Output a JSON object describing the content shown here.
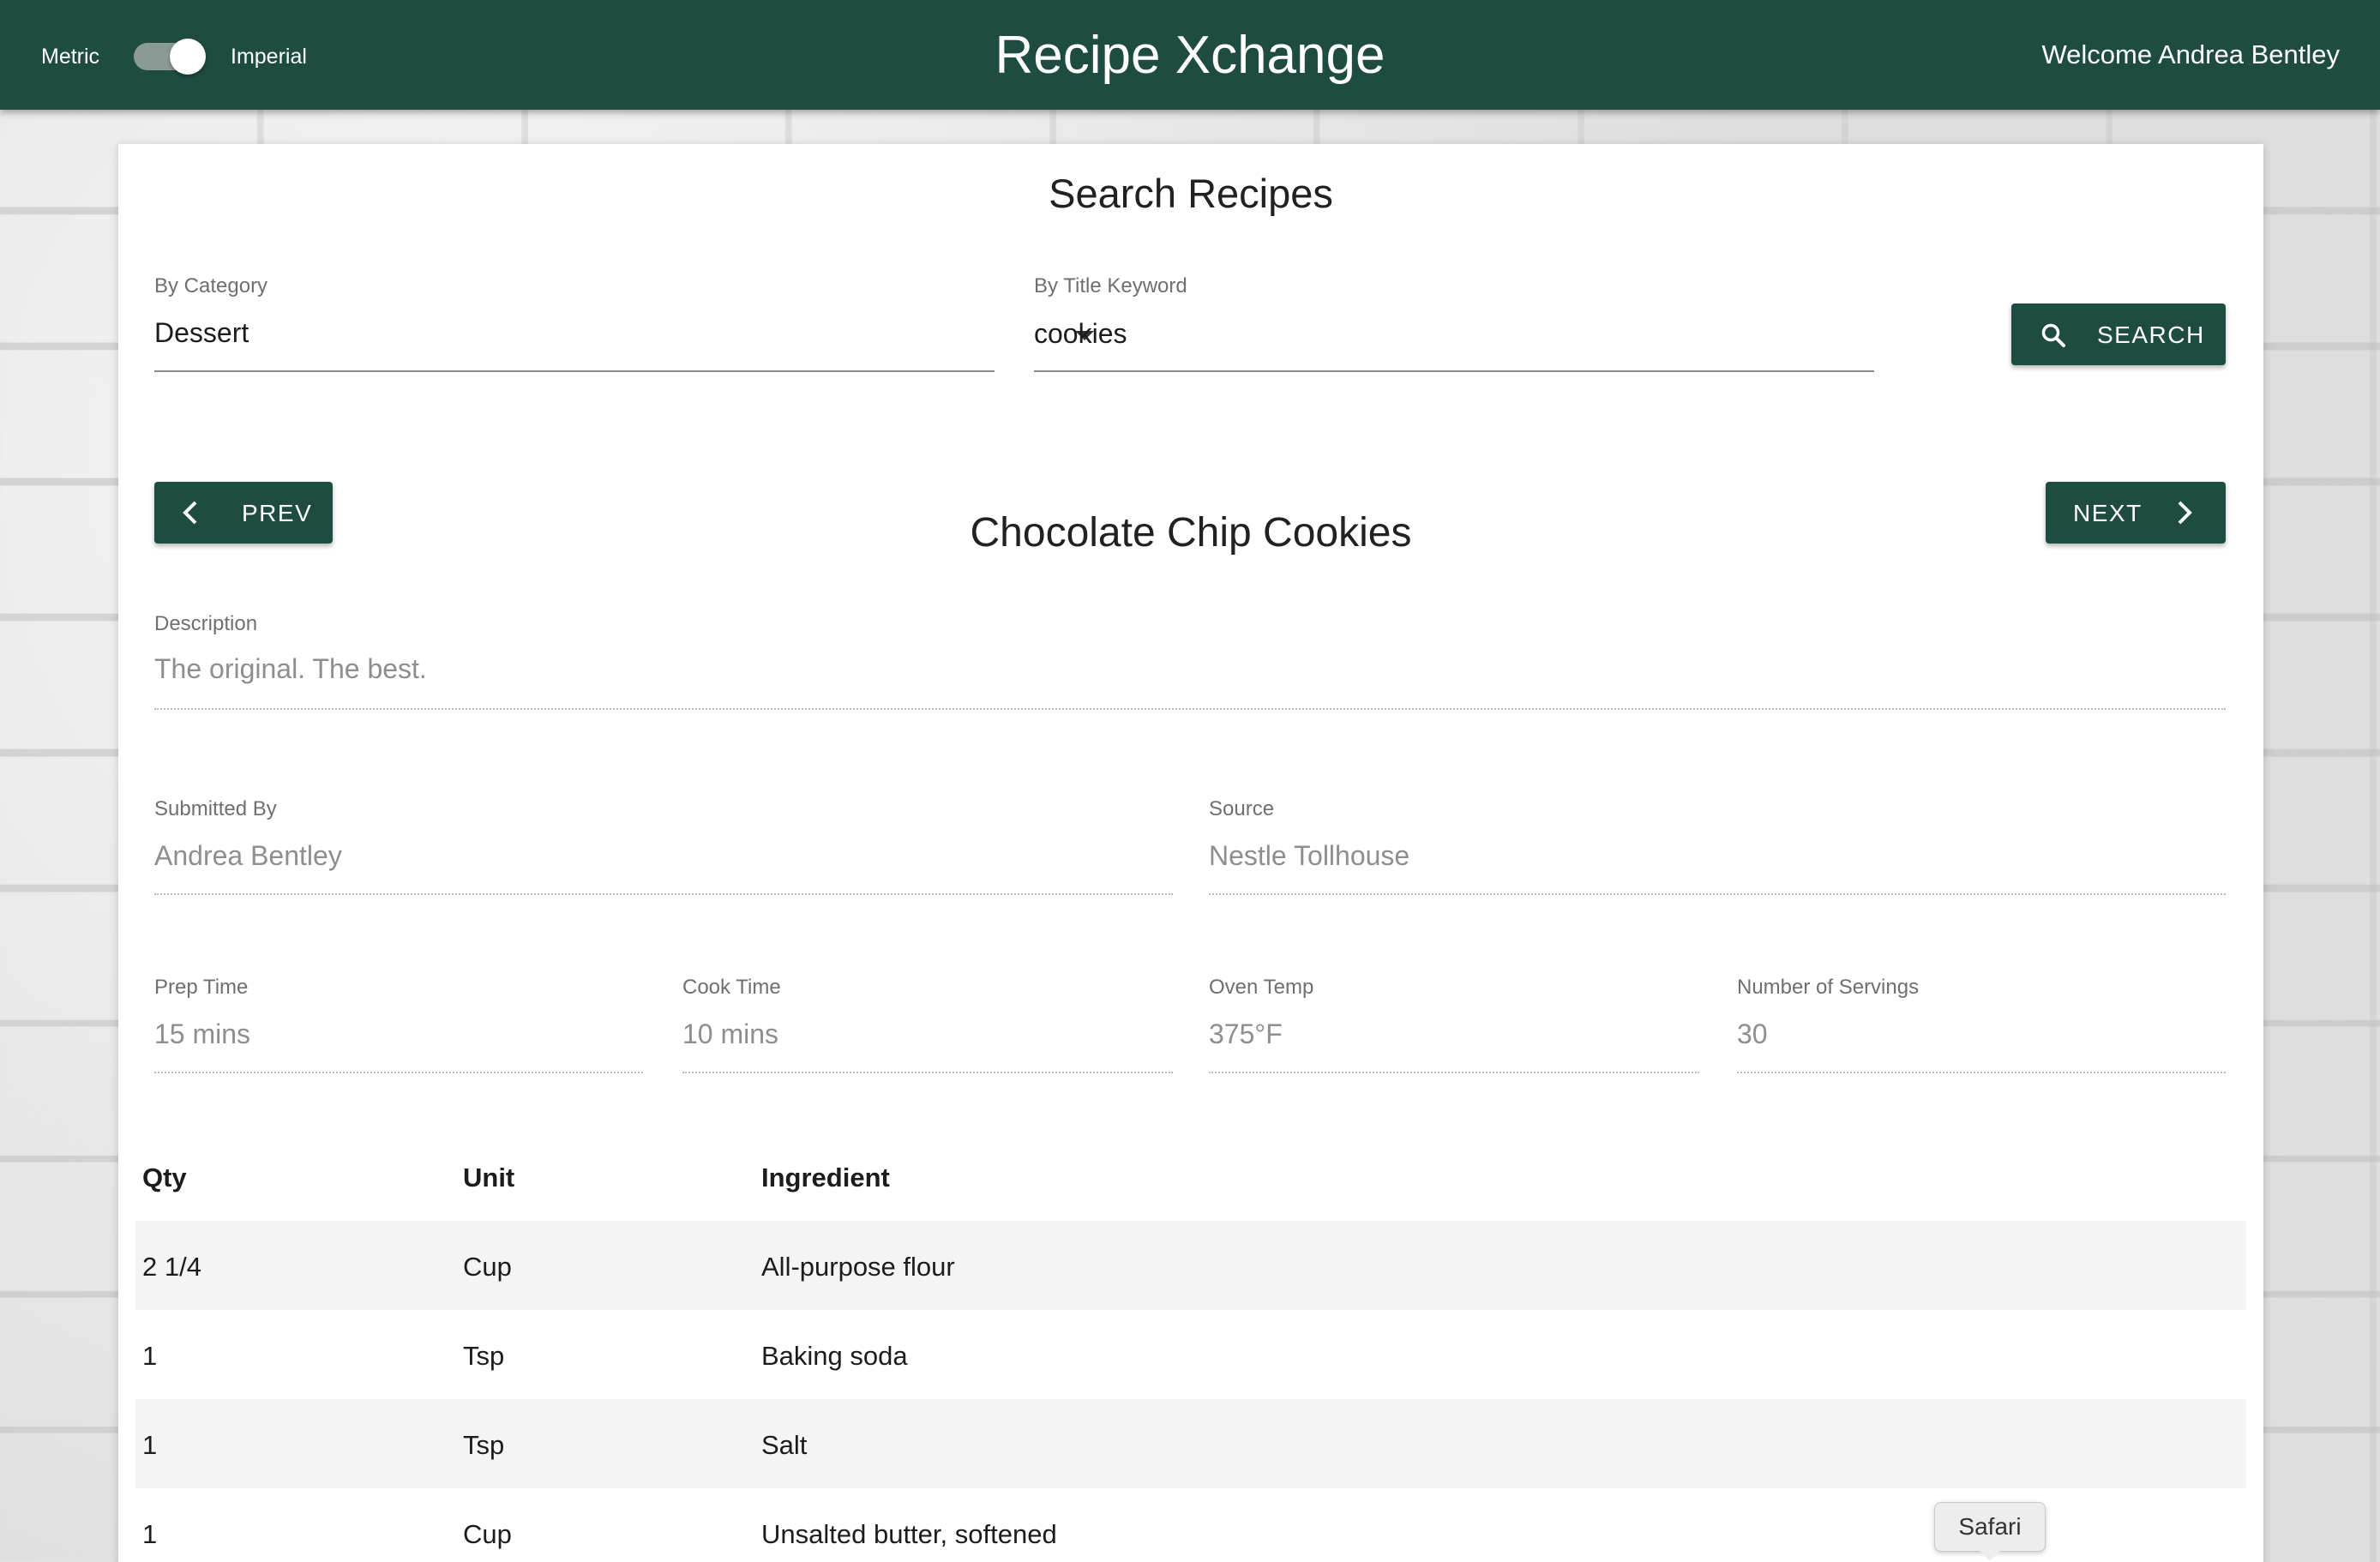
{
  "header": {
    "metric_label": "Metric",
    "imperial_label": "Imperial",
    "unit_toggle_on": true,
    "app_title": "Recipe Xchange",
    "welcome": "Welcome Andrea Bentley"
  },
  "search": {
    "title": "Search Recipes",
    "category_label": "By Category",
    "category_value": "Dessert",
    "keyword_label": "By Title Keyword",
    "keyword_value": "cookies",
    "search_button": "SEARCH"
  },
  "nav": {
    "prev": "PREV",
    "next": "NEXT"
  },
  "recipe": {
    "title": "Chocolate Chip Cookies",
    "description_label": "Description",
    "description": "The original. The best.",
    "submitted_by_label": "Submitted By",
    "submitted_by": "Andrea Bentley",
    "source_label": "Source",
    "source": "Nestle Tollhouse",
    "prep_time_label": "Prep Time",
    "prep_time": "15 mins",
    "cook_time_label": "Cook Time",
    "cook_time": "10 mins",
    "oven_temp_label": "Oven Temp",
    "oven_temp": "375°F",
    "servings_label": "Number of Servings",
    "servings": "30"
  },
  "ingredients": {
    "headers": [
      "Qty",
      "Unit",
      "Ingredient"
    ],
    "rows": [
      [
        "2 1/4",
        "Cup",
        "All-purpose flour"
      ],
      [
        "1",
        "Tsp",
        "Baking soda"
      ],
      [
        "1",
        "Tsp",
        "Salt"
      ],
      [
        "1",
        "Cup",
        "Unsalted butter, softened"
      ]
    ]
  },
  "tooltip": {
    "text": "Safari"
  },
  "colors": {
    "primary": "#1f4c41",
    "panel": "#ffffff",
    "muted_text": "#8e8e8e"
  }
}
